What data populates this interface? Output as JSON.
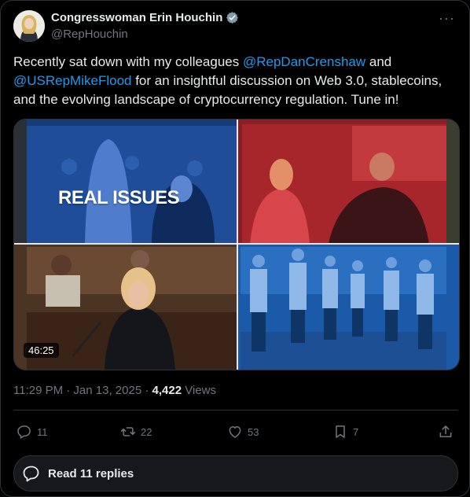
{
  "author": {
    "display_name": "Congresswoman Erin Houchin",
    "handle": "@RepHouchin",
    "verified_icon": "verified-badge-icon"
  },
  "more_label": "···",
  "tweet": {
    "text_part1": "Recently sat down with my colleagues ",
    "mention1": "@RepDanCrenshaw",
    "text_part2": " and",
    "mention2": "@USRepMikeFlood",
    "text_part3": " for an insightful discussion on Web 3.0, stablecoins, and the evolving landscape of cryptocurrency regulation. Tune in!"
  },
  "media": {
    "overlay_text": "REAL ISSUES",
    "duration": "46:25"
  },
  "meta": {
    "time": "11:29 PM · Jan 13, 2025 · ",
    "views_count": "4,422",
    "views_label": " Views"
  },
  "actions": {
    "reply_count": "11",
    "retweet_count": "22",
    "like_count": "53",
    "bookmark_count": "7"
  },
  "read_replies_label": "Read 11 replies",
  "colors": {
    "background": "#000000",
    "text": "#e7e9ea",
    "muted": "#71767b",
    "accent": "#1d9bf0",
    "border": "#2f3336"
  }
}
